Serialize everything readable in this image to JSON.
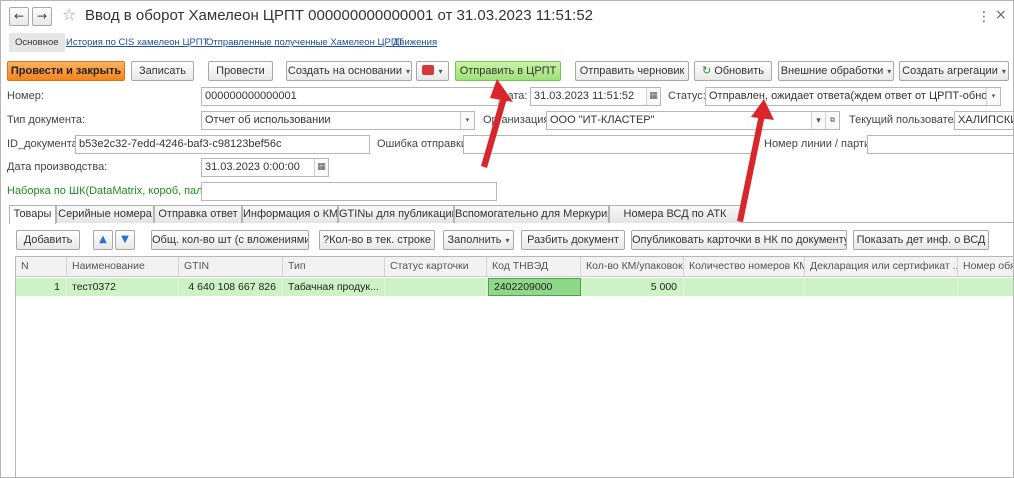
{
  "window": {
    "title": "Ввод в оборот Хамелеон ЦРПТ 000000000000001 от 31.03.2023 11:51:52",
    "back_glyph": "←",
    "forward_glyph": "→",
    "star_glyph": "☆",
    "more_glyph": "⋮",
    "close_glyph": "×"
  },
  "link_tabs": {
    "main": "Основное",
    "history": "История по CIS хамелеон ЦРПТ",
    "sent": "Отправленные полученные Хамелеон ЦРПТ",
    "movements": "Движения"
  },
  "toolbar": {
    "post_close": "Провести и закрыть",
    "save": "Записать",
    "post": "Провести",
    "create_based": "Создать на основании",
    "send_crpt": "Отправить в ЦРПТ",
    "send_draft": "Отправить черновик",
    "refresh": "Обновить",
    "external": "Внешние обработки",
    "create_aggregation": "Создать агрегации",
    "caret": "▾"
  },
  "form": {
    "number_label": "Номер:",
    "number_value": "000000000000001",
    "date_label": "Дата:",
    "date_value": "31.03.2023 11:51:52",
    "status_label": "Статус:",
    "status_value": "Отправлен, ожидает ответа(ждем ответ от ЦРПТ-обновите с",
    "doc_type_label": "Тип документа:",
    "doc_type_value": "Отчет об использовании",
    "org_label": "Организация:",
    "org_value": "ООО \"ИТ-КЛАСТЕР\"",
    "user_label": "Текущий пользователь:",
    "user_value": "ХАЛИПСКИЙ",
    "doc_id_label": "ID_документа:",
    "doc_id_value": "b53e2c32-7edd-4246-baf3-c98123bef56c",
    "send_error_label": "Ошибка отправки:",
    "send_error_value": "",
    "line_label": "Номер линии / партии:",
    "line_value": "",
    "prod_date_label": "Дата производства:",
    "prod_date_value": "31.03.2023  0:00:00",
    "scan_label": "Наборка по ШК(DataMatrix, короб, паллет):",
    "scan_value": "",
    "calendar_glyph": "▦",
    "open_glyph": "⧉"
  },
  "tabs": [
    "Товары",
    "Серийные номера",
    "Отправка ответ",
    "Информация о КМ",
    "GTINы для публикации",
    "Вспомогательно для Меркурия",
    "Номера ВСД по АТК"
  ],
  "table_toolbar": {
    "add": "Добавить",
    "up_glyph": "🡅",
    "down_glyph": "🡇",
    "total_qty": "Общ. кол-во шт (с вложениями)",
    "qty_row": "?Кол-во в тек. строке",
    "fill": "Заполнить",
    "split": "Разбить документ",
    "publish": "Опубликовать карточки в НК по документу",
    "show_vsd": "Показать дет инф. о ВСД"
  },
  "table": {
    "columns": [
      "N",
      "Наименование",
      "GTIN",
      "Тип",
      "Статус карточки",
      "Код ТНВЭД",
      "Кол-во КМ/упаковок",
      "Количество номеров КМ",
      "Декларация или сертификат ...",
      "Номер обяз..."
    ],
    "rows": [
      {
        "n": "1",
        "name": "тест0372",
        "gtin": "4 640 108 667 826",
        "type": "Табачная продук...",
        "card_status": "",
        "tnved": "2402209000",
        "qty": "5 000",
        "km_count": "",
        "declaration": "",
        "obligation": ""
      }
    ]
  },
  "colors": {
    "primary_button": "#f2851c",
    "send_button": "#9fe079",
    "selected_row": "#cdf2c6",
    "annotation_arrow": "#d9262c"
  }
}
